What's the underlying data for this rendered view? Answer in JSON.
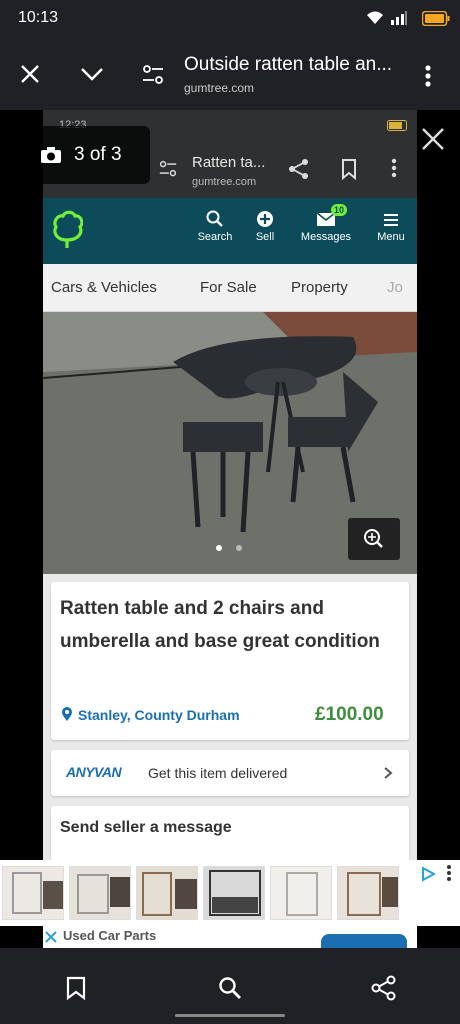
{
  "status": {
    "time": "10:13"
  },
  "browser": {
    "title": "Outside ratten table an...",
    "url": "gumtree.com"
  },
  "viewer": {
    "counter": "3 of 3"
  },
  "inner": {
    "status_time": "12:23",
    "browser_title": "Ratten ta...",
    "browser_url": "gumtree.com",
    "header": {
      "search": "Search",
      "sell": "Sell",
      "messages": "Messages",
      "messages_badge": "10",
      "menu": "Menu"
    },
    "nav": [
      "Cars & Vehicles",
      "For Sale",
      "Property",
      "Jo"
    ],
    "listing": {
      "title": "Ratten table and 2 chairs and umberella and base great condition",
      "location": "Stanley, County Durham",
      "price": "£100.00"
    },
    "delivery": {
      "brand": "ANYVAN",
      "text": "Get this item delivered"
    },
    "message_heading": "Send seller a message",
    "footer_text": "Used Car Parts"
  },
  "colors": {
    "gumtree_green": "#72ef36",
    "gumtree_teal": "#0b4b5a",
    "price_green": "#3c8d3c",
    "link_blue": "#1a6fb0",
    "battery_orange": "#f5a623"
  }
}
